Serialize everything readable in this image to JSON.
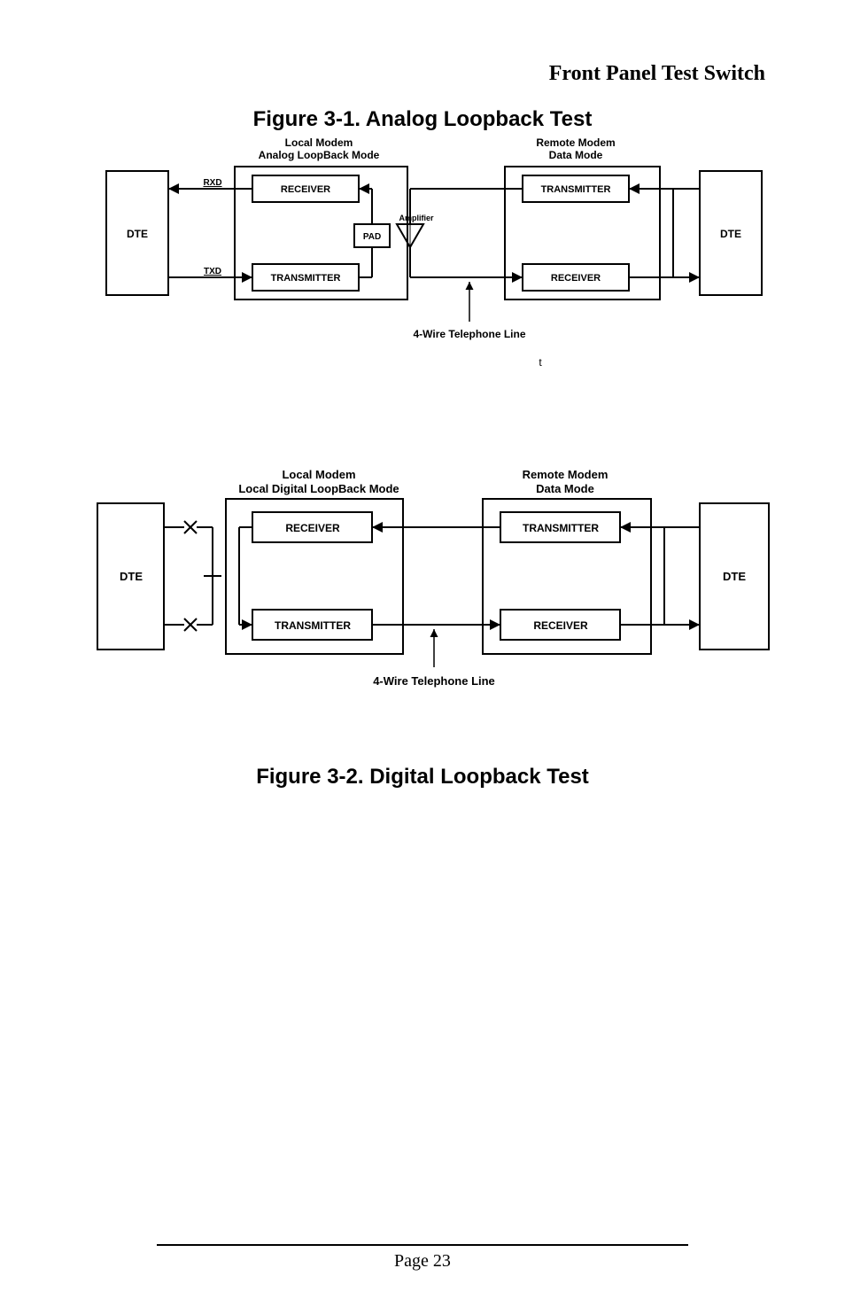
{
  "header": {
    "title": "Front Panel Test Switch"
  },
  "fig1": {
    "title": "Figure 3-1. Analog Loopback Test",
    "local_label1": "Local Modem",
    "local_label2": "Analog LoopBack Mode",
    "remote_label1": "Remote Modem",
    "remote_label2": "Data Mode",
    "rxd": "RXD",
    "txd": "TXD",
    "dte_left": "DTE",
    "dte_right": "DTE",
    "receiver": "RECEIVER",
    "transmitter": "TRANSMITTER",
    "amplifier": "Amplifier",
    "pad": "PAD",
    "line_label": "4-Wire Telephone Line",
    "tick": "t"
  },
  "fig2": {
    "local_label1": "Local Modem",
    "local_label2": "Local Digital LoopBack Mode",
    "remote_label1": "Remote Modem",
    "remote_label2": "Data Mode",
    "dte_left": "DTE",
    "dte_right": "DTE",
    "receiver": "RECEIVER",
    "transmitter": "TRANSMITTER",
    "line_label": "4-Wire Telephone Line",
    "title": "Figure 3-2. Digital Loopback Test"
  },
  "footer": {
    "page": "Page 23"
  }
}
